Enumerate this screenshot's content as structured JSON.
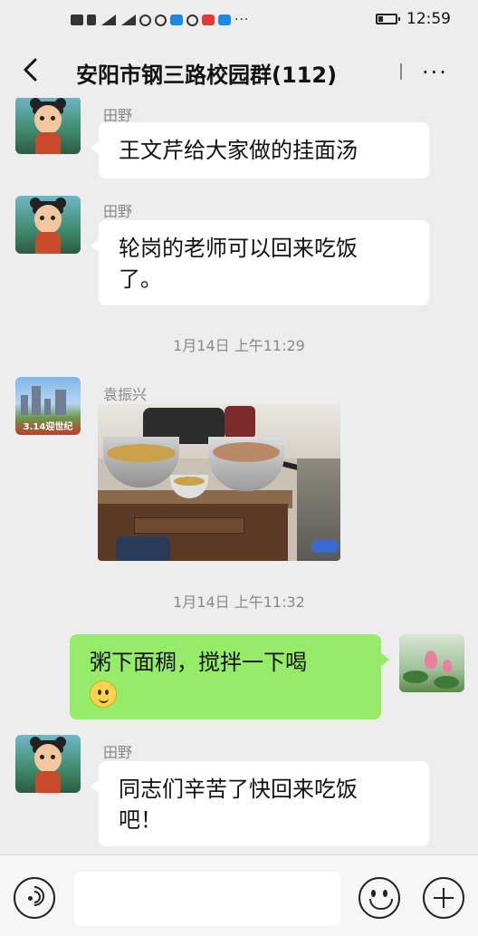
{
  "status_bar": {
    "time": "12:59",
    "icons": [
      "signal-icon",
      "wifi-icon",
      "app-notification-icons",
      "battery-icon"
    ]
  },
  "header": {
    "title": "安阳市钢三路校园群(112)",
    "back_icon": "back-arrow-icon",
    "more_icon": "more-icon"
  },
  "messages": [
    {
      "sender": "田野",
      "text": "王文芹给大家做的挂面汤",
      "side": "left",
      "avatar": "nezha-avatar"
    },
    {
      "sender": "田野",
      "text": "轮岗的老师可以回来吃饭了。",
      "line1": "轮岗的老师可以回来吃饭",
      "line2": "了。",
      "side": "left",
      "avatar": "nezha-avatar"
    },
    {
      "timestamp": "1月14日 上午11:29"
    },
    {
      "sender": "袁振兴",
      "type": "image",
      "image_desc": "kitchen-photo",
      "side": "left",
      "avatar": "city-avatar",
      "avatar_caption": "3.14迎世纪"
    },
    {
      "timestamp": "1月14日 上午11:32"
    },
    {
      "text": "粥下面稠，搅拌一下喝",
      "emoji": "smile-emoji",
      "side": "right",
      "avatar": "lotus-avatar"
    },
    {
      "sender": "田野",
      "text": "同志们辛苦了快回来吃饭吧！",
      "line1": "同志们辛苦了快回来吃饭",
      "line2": "吧！",
      "side": "left",
      "avatar": "nezha-avatar"
    }
  ],
  "input_bar": {
    "voice_icon": "voice-icon",
    "input_value": "",
    "emoji_icon": "emoji-icon",
    "plus_icon": "plus-icon"
  }
}
